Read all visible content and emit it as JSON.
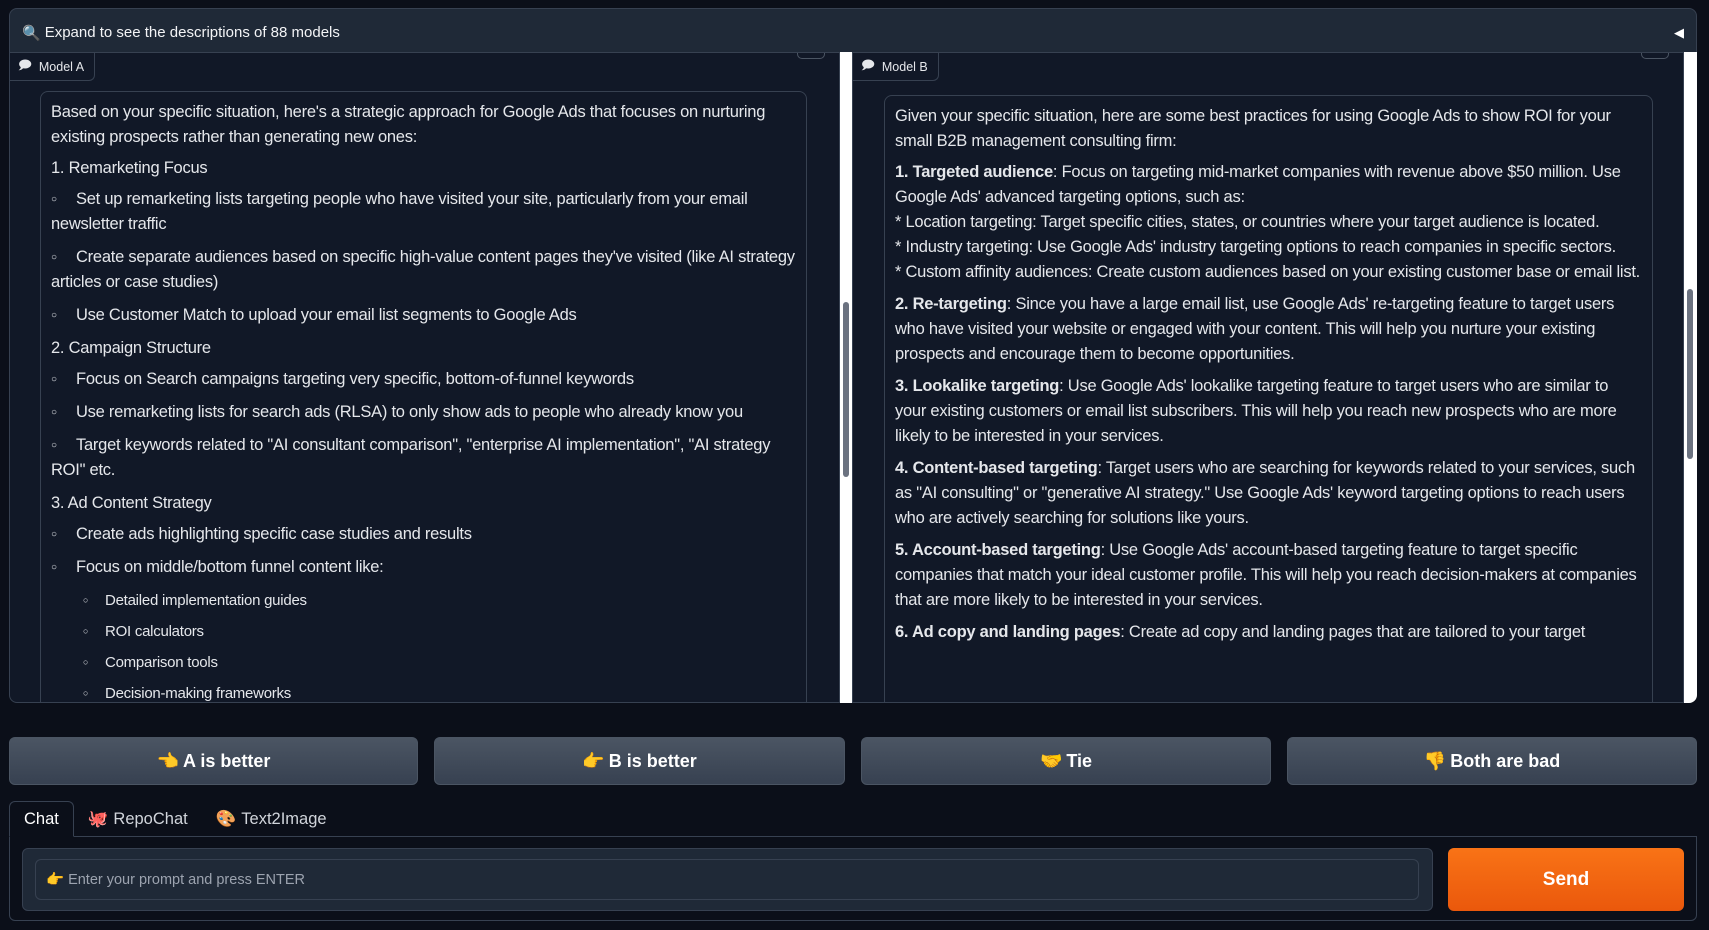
{
  "accordion": {
    "icon": "🔍",
    "label": "Expand to see the descriptions of 88 models"
  },
  "model_a": {
    "label": "Model A",
    "intro": "Based on your specific situation, here's a strategic approach for Google Ads that focuses on nurturing existing prospects rather than generating new ones:",
    "sections": [
      {
        "heading": "1. Remarketing Focus",
        "items": [
          "Set up remarketing lists targeting people who have visited your site, particularly from your email newsletter traffic",
          "Create separate audiences based on specific high-value content pages they've visited (like AI strategy articles or case studies)",
          "Use Customer Match to upload your email list segments to Google Ads"
        ]
      },
      {
        "heading": "2. Campaign Structure",
        "items": [
          "Focus on Search campaigns targeting very specific, bottom-of-funnel keywords",
          "Use remarketing lists for search ads (RLSA) to only show ads to people who already know you",
          "Target keywords related to \"AI consultant comparison\", \"enterprise AI implementation\", \"AI strategy ROI\" etc."
        ]
      },
      {
        "heading": "3. Ad Content Strategy",
        "items": [
          "Create ads highlighting specific case studies and results",
          "Focus on middle/bottom funnel content like:"
        ],
        "subitems": [
          "Detailed implementation guides",
          "ROI calculators",
          "Comparison tools",
          "Decision-making frameworks"
        ]
      }
    ]
  },
  "model_b": {
    "label": "Model B",
    "intro": "Given your specific situation, here are some best practices for using Google Ads to show ROI for your small B2B management consulting firm:",
    "points": [
      {
        "title": "1. Targeted audience",
        "text": ": Focus on targeting mid-market companies with revenue above $50 million. Use Google Ads' advanced targeting options, such as:",
        "extra": [
          "* Location targeting: Target specific cities, states, or countries where your target audience is located.",
          "* Industry targeting: Use Google Ads' industry targeting options to reach companies in specific sectors.",
          "* Custom affinity audiences: Create custom audiences based on your existing customer base or email list."
        ]
      },
      {
        "title": "2. Re-targeting",
        "text": ": Since you have a large email list, use Google Ads' re-targeting feature to target users who have visited your website or engaged with your content. This will help you nurture your existing prospects and encourage them to become opportunities."
      },
      {
        "title": "3. Lookalike targeting",
        "text": ": Use Google Ads' lookalike targeting feature to target users who are similar to your existing customers or email list subscribers. This will help you reach new prospects who are more likely to be interested in your services."
      },
      {
        "title": "4. Content-based targeting",
        "text": ": Target users who are searching for keywords related to your services, such as \"AI consulting\" or \"generative AI strategy.\" Use Google Ads' keyword targeting options to reach users who are actively searching for solutions like yours."
      },
      {
        "title": "5. Account-based targeting",
        "text": ": Use Google Ads' account-based targeting feature to target specific companies that match your ideal customer profile. This will help you reach decision-makers at companies that are more likely to be interested in your services."
      },
      {
        "title": "6. Ad copy and landing pages",
        "text": ": Create ad copy and landing pages that are tailored to your target"
      }
    ]
  },
  "vote": [
    {
      "icon": "👈",
      "label": "A is better"
    },
    {
      "icon": "👉",
      "label": "B is better"
    },
    {
      "icon": "🤝",
      "label": "Tie"
    },
    {
      "icon": "👎",
      "label": "Both are bad"
    }
  ],
  "tabs": [
    {
      "icon": "",
      "label": "Chat"
    },
    {
      "icon": "🐙",
      "label": "RepoChat"
    },
    {
      "icon": "🎨",
      "label": "Text2Image"
    }
  ],
  "input": {
    "icon": "👉",
    "placeholder": "Enter your prompt and press ENTER"
  },
  "send_label": "Send",
  "colors": {
    "accent": "#f97316",
    "bg": "#0b0f19",
    "panel": "#111827"
  }
}
